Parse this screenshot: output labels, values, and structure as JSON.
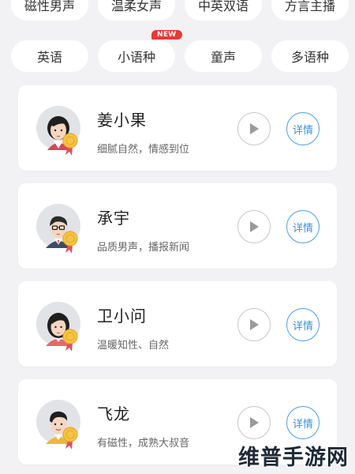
{
  "categories_row1": [
    {
      "label": "磁性男声"
    },
    {
      "label": "温柔女声"
    },
    {
      "label": "中英双语"
    },
    {
      "label": "方言主播"
    }
  ],
  "categories_row2": [
    {
      "label": "英语",
      "badge": ""
    },
    {
      "label": "小语种",
      "badge": "NEW"
    },
    {
      "label": "童声",
      "badge": ""
    },
    {
      "label": "多语种",
      "badge": ""
    }
  ],
  "voices": [
    {
      "name": "姜小果",
      "desc": "细腻自然，情感到位",
      "detail_label": "详情",
      "avatar_icon": "female-avatar-icon"
    },
    {
      "name": "承宇",
      "desc": "品质男声，播报新闻",
      "detail_label": "详情",
      "avatar_icon": "male-glasses-avatar-icon"
    },
    {
      "name": "卫小问",
      "desc": "温暖知性、自然",
      "detail_label": "详情",
      "avatar_icon": "female-avatar-icon"
    },
    {
      "name": "飞龙",
      "desc": "有磁性，成熟大叔音",
      "detail_label": "详情",
      "avatar_icon": "male-avatar-icon"
    }
  ],
  "watermark": "维普手游网",
  "colors": {
    "accent": "#3a8fd8",
    "badge": "#e53935",
    "background": "#f2f2f4"
  }
}
